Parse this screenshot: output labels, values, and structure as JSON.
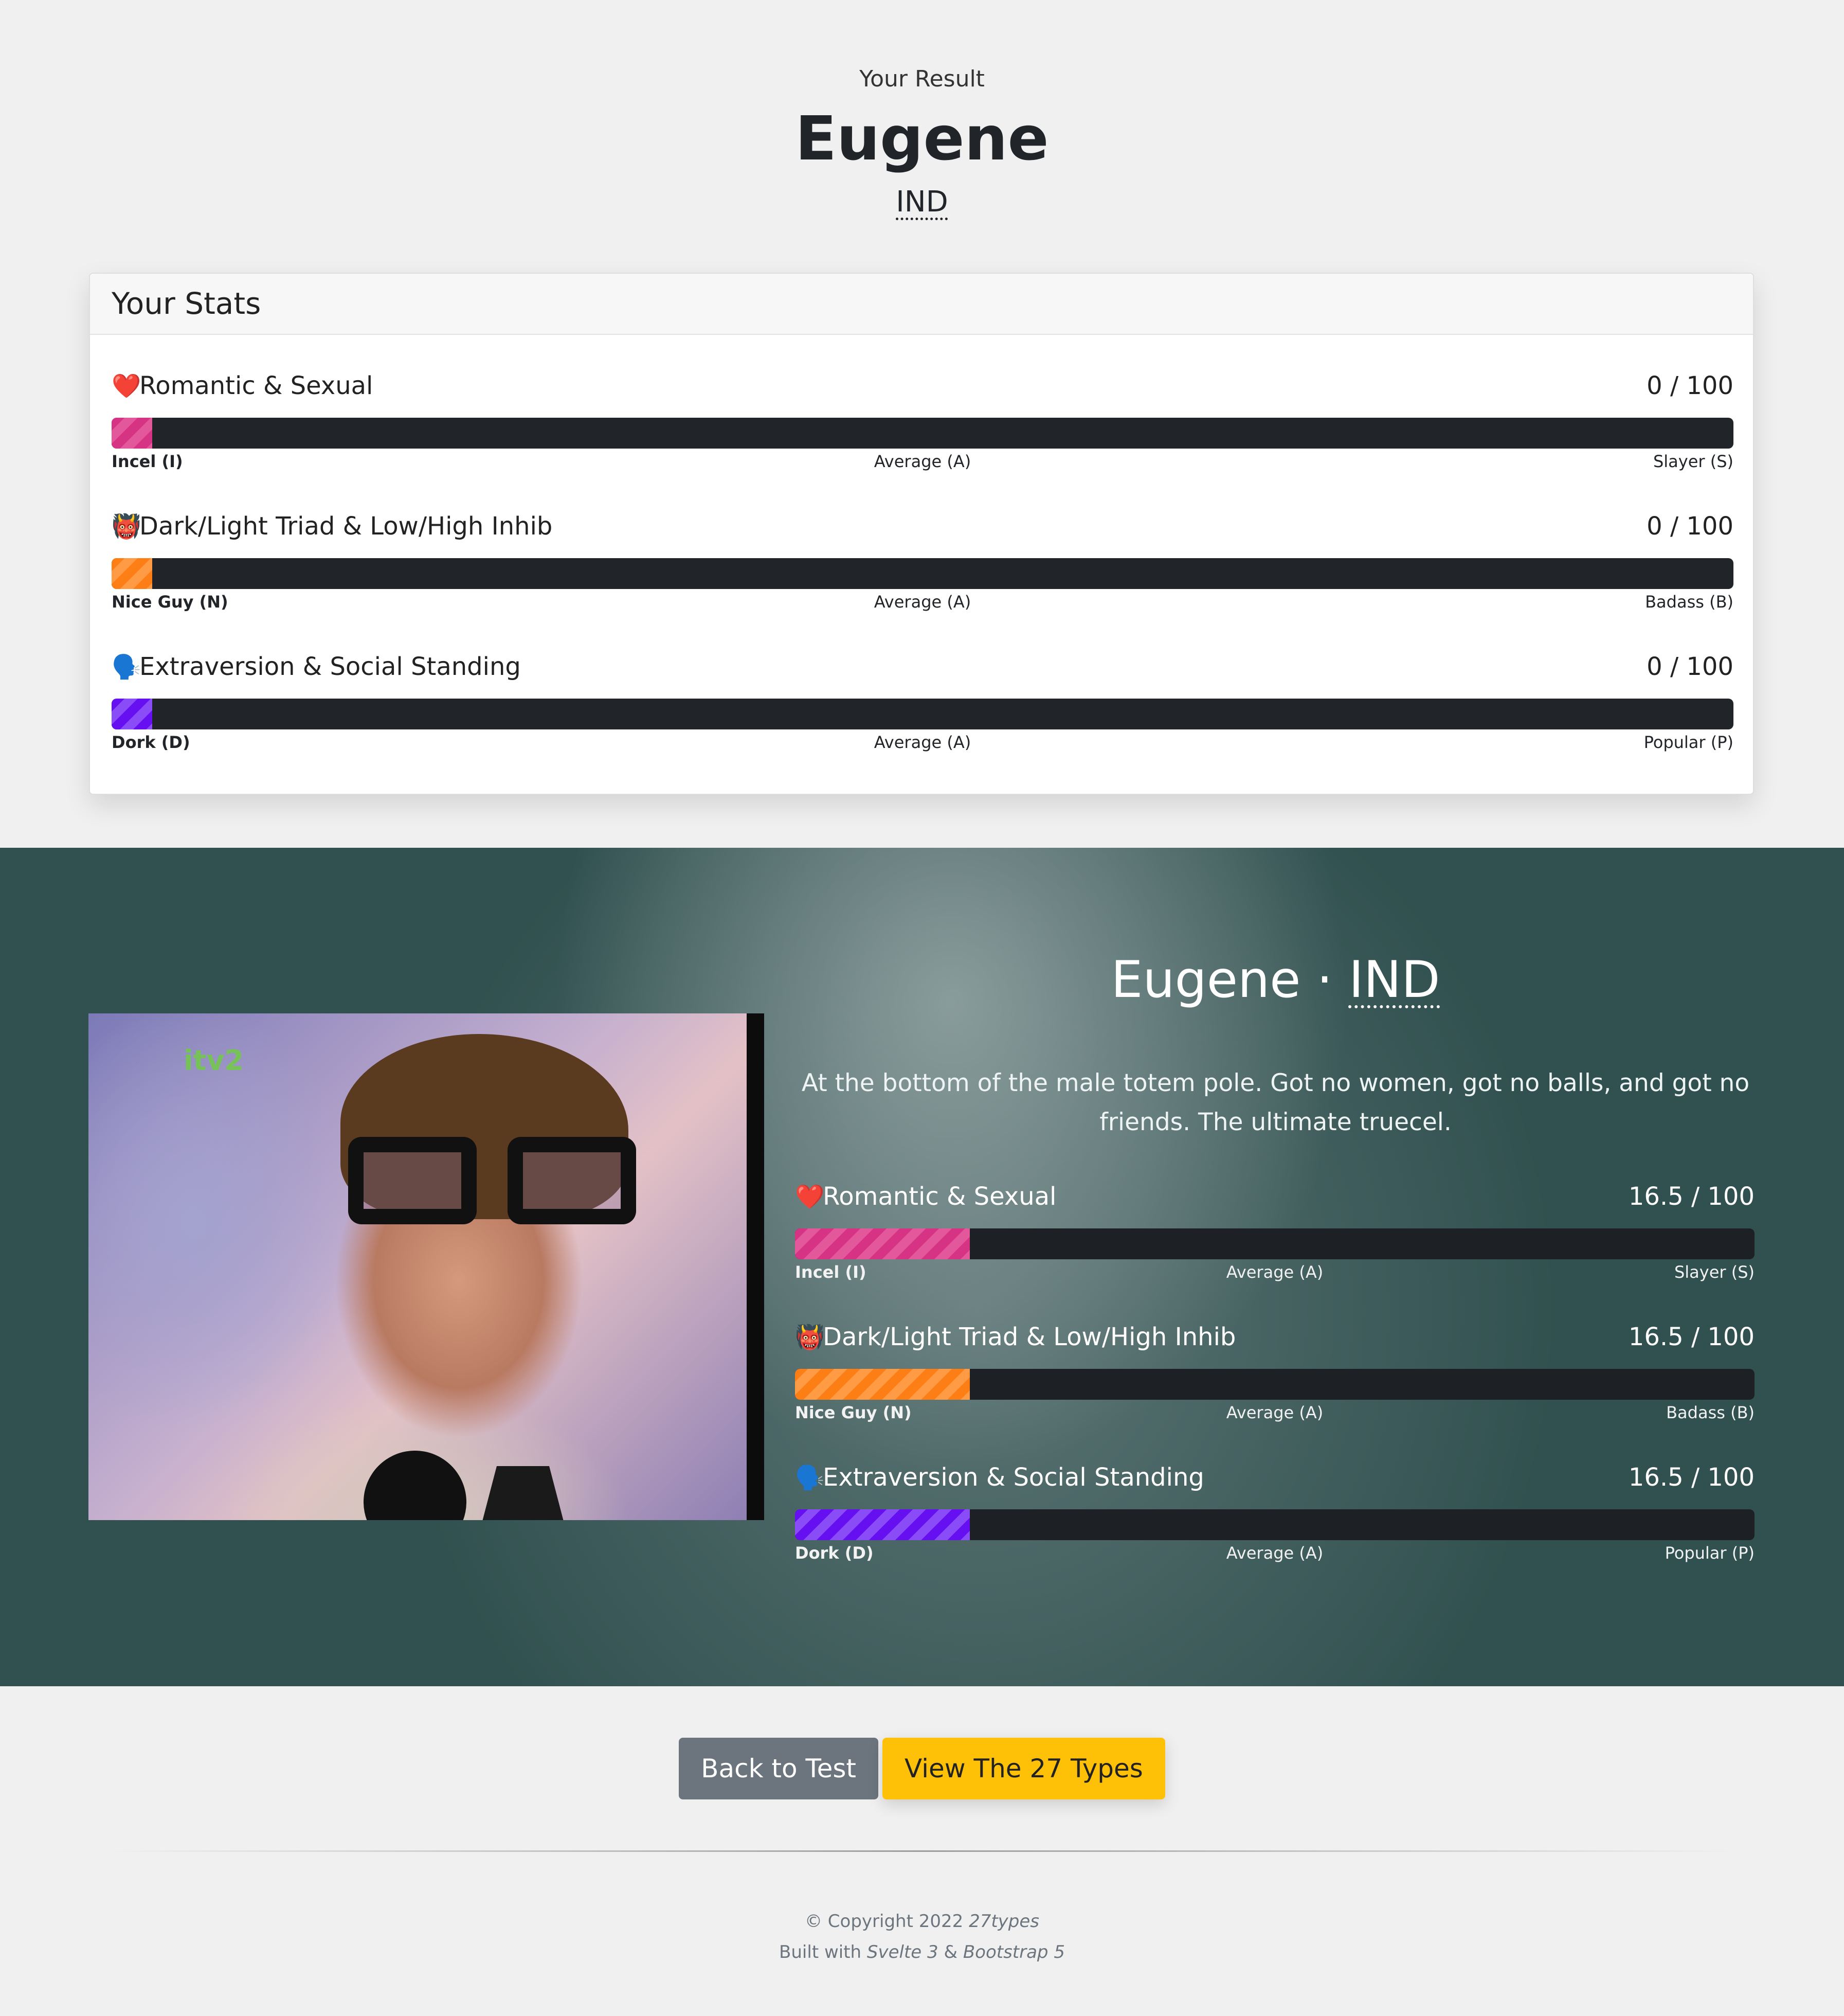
{
  "header": {
    "label": "Your Result",
    "name": "Eugene",
    "code": "IND"
  },
  "your_stats": {
    "title": "Your Stats",
    "stats": [
      {
        "emoji": "❤️",
        "title": "Romantic & Sexual",
        "score": "0 / 100",
        "fill_percent": 2.5,
        "color": "#d63384",
        "low": "Incel (I)",
        "mid": "Average (A)",
        "high": "Slayer (S)"
      },
      {
        "emoji": "👹",
        "title": "Dark/Light Triad & Low/High Inhib",
        "score": "0 / 100",
        "fill_percent": 2.5,
        "color": "#fd7e14",
        "low": "Nice Guy (N)",
        "mid": "Average (A)",
        "high": "Badass (B)"
      },
      {
        "emoji": "🗣️",
        "title": "Extraversion & Social Standing",
        "score": "0 / 100",
        "fill_percent": 2.5,
        "color": "#6610f2",
        "low": "Dork (D)",
        "mid": "Average (A)",
        "high": "Popular (P)"
      }
    ]
  },
  "type_card": {
    "name": "Eugene",
    "separator": "·",
    "code": "IND",
    "description": "At the bottom of the male totem pole. Got no women, got no balls, and got no friends. The ultimate truecel.",
    "image_alt": "Eugene",
    "stats": [
      {
        "emoji": "❤️",
        "title": "Romantic & Sexual",
        "score": "16.5 / 100",
        "fill_percent": 18.2,
        "color": "#d63384",
        "low": "Incel (I)",
        "mid": "Average (A)",
        "high": "Slayer (S)"
      },
      {
        "emoji": "👹",
        "title": "Dark/Light Triad & Low/High Inhib",
        "score": "16.5 / 100",
        "fill_percent": 18.2,
        "color": "#fd7e14",
        "low": "Nice Guy (N)",
        "mid": "Average (A)",
        "high": "Badass (B)"
      },
      {
        "emoji": "🗣️",
        "title": "Extraversion & Social Standing",
        "score": "16.5 / 100",
        "fill_percent": 18.2,
        "color": "#6610f2",
        "low": "Dork (D)",
        "mid": "Average (A)",
        "high": "Popular (P)"
      }
    ]
  },
  "buttons": {
    "back": "Back to Test",
    "view_types": "View The 27 Types"
  },
  "footer": {
    "copyright_prefix": "© Copyright 2022",
    "site": "27types",
    "built_prefix": "Built with",
    "framework1": "Svelte 3",
    "amp": "&",
    "framework2": "Bootstrap 5"
  }
}
